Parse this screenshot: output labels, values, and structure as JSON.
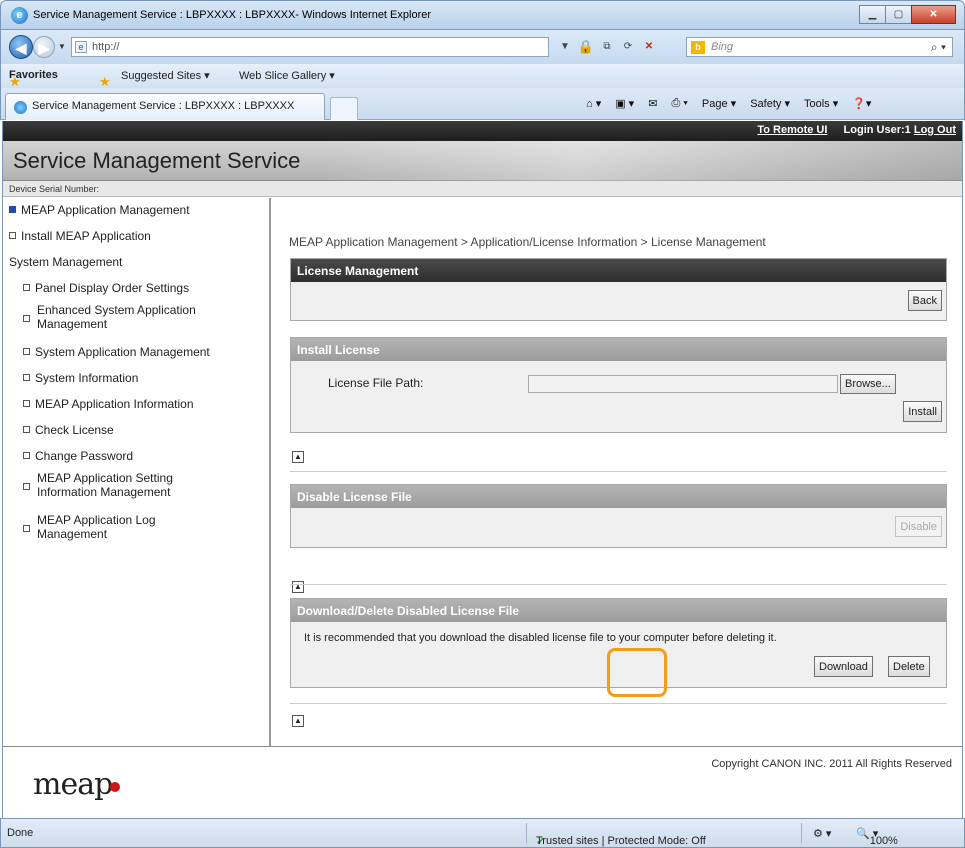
{
  "browser": {
    "window_title": "Service Management Service : LBPXXXX : LBPXXXX- Windows Internet Explorer",
    "url": "http://",
    "search_placeholder": "Bing",
    "favorites_label": "Favorites",
    "suggested_sites": "Suggested Sites ▾",
    "web_slice": "Web Slice Gallery ▾",
    "tab_title": "Service Management Service : LBPXXXX : LBPXXXX",
    "commands": {
      "page": "Page ▾",
      "safety": "Safety ▾",
      "tools": "Tools ▾"
    },
    "status": {
      "done": "Done",
      "zone": "Trusted sites | Protected Mode: Off",
      "zoom": "100%"
    }
  },
  "topstrip": {
    "remote_ui": "To Remote UI",
    "login_user": "Login User:1",
    "logout": "Log Out"
  },
  "header": {
    "title": "Service Management Service",
    "serial_label": "Device Serial Number:"
  },
  "sidebar": {
    "meap_app_mgmt": "MEAP Application Management",
    "install_meap": "Install MEAP Application",
    "system_mgmt": "System Management",
    "panel_display": "Panel Display Order Settings",
    "enhanced_l1": "Enhanced System Application",
    "enhanced_l2": "Management",
    "sys_app_mgmt": "System Application Management",
    "sys_info": "System Information",
    "meap_app_info": "MEAP Application Information",
    "check_license": "Check License",
    "change_password": "Change Password",
    "setting_l1": "MEAP Application Setting",
    "setting_l2": "Information Management",
    "log_l1": "MEAP Application Log",
    "log_l2": "Management"
  },
  "main": {
    "breadcrumb": "MEAP Application Management > Application/License Information > License Management",
    "license_mgmt": {
      "title": "License Management",
      "back": "Back"
    },
    "install_license": {
      "title": "Install License",
      "path_label": "License File Path:",
      "browse": "Browse...",
      "install": "Install"
    },
    "disable": {
      "title": "Disable License File",
      "button": "Disable"
    },
    "download_delete": {
      "title": "Download/Delete Disabled License File",
      "message": "It is recommended that you download the disabled license file to your computer before deleting it.",
      "download": "Download",
      "delete": "Delete"
    }
  },
  "footer": {
    "logo": "meap",
    "copyright": "Copyright CANON INC. 2011 All Rights Reserved"
  },
  "colors": {
    "accent_highlight": "#f29d1b",
    "header_dark": "#2e2e2e",
    "link_blue": "#1f4ea8"
  }
}
